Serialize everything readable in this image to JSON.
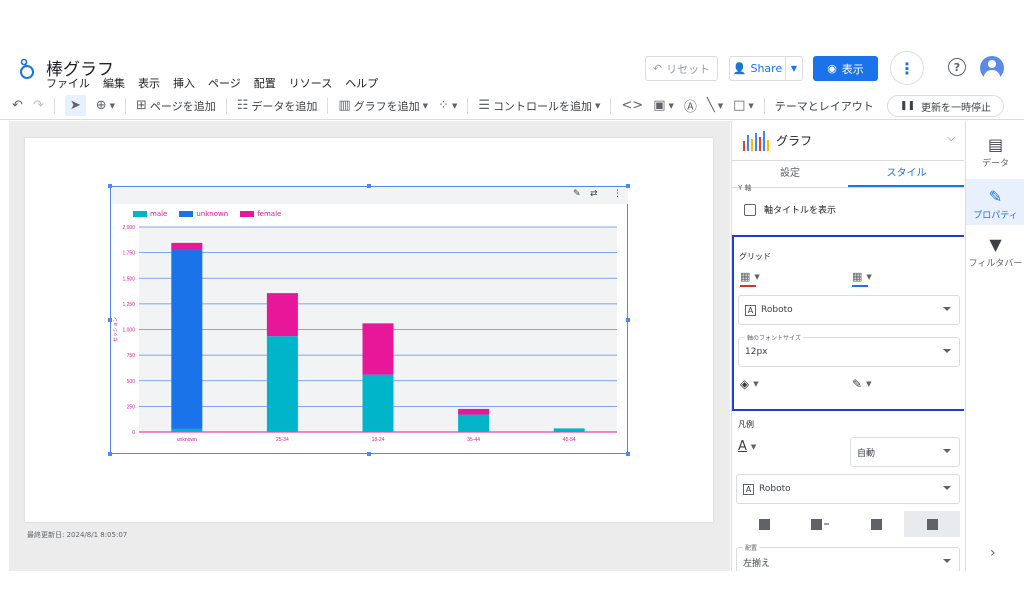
{
  "app": {
    "title": "棒グラフ",
    "menu": [
      "ファイル",
      "編集",
      "表示",
      "挿入",
      "ページ",
      "配置",
      "リソース",
      "ヘルプ"
    ],
    "reset_label": "リセット",
    "share_label": "Share",
    "view_label": "表示"
  },
  "toolbar": {
    "add_page": "ページを追加",
    "add_data": "データを追加",
    "add_chart": "グラフを追加",
    "add_control": "コントロールを追加",
    "theme_layout": "テーマとレイアウト",
    "pause_updates": "更新を一時停止"
  },
  "canvas": {
    "last_updated": "最終更新日: 2024/8/1 8:05:07"
  },
  "chart_data": {
    "type": "bar",
    "stacked": true,
    "categories": [
      "unknown",
      "25-34",
      "18-24",
      "35-44",
      "45-54"
    ],
    "series": [
      {
        "name": "male",
        "color": "#00b4c9",
        "values": [
          30,
          935,
          560,
          170,
          35
        ]
      },
      {
        "name": "unknown",
        "color": "#1a73e8",
        "values": [
          1755,
          0,
          0,
          0,
          0
        ]
      },
      {
        "name": "female",
        "color": "#e8179a",
        "values": [
          60,
          420,
          500,
          55,
          0
        ]
      }
    ],
    "ylabel": "セッション",
    "ylim": [
      0,
      2000
    ],
    "yticks": [
      "0",
      "250",
      "500",
      "750",
      "1,000",
      "1,250",
      "1,500",
      "1,750",
      "2,000"
    ],
    "grid": true,
    "legend_position": "top-left"
  },
  "panel": {
    "chart_type_label": "グラフ",
    "tab_setup": "設定",
    "tab_style": "スタイル",
    "axis_section_label": "Y 軸",
    "show_axis_title": "軸タイトルを表示",
    "grid_section": "グリッド",
    "font_family": "Roboto",
    "axis_font_size_label": "軸のフォントサイズ",
    "axis_font_size": "12px",
    "legend_section": "凡例",
    "legend_auto": "自動",
    "legend_font": "Roboto",
    "alignment_label": "配置",
    "alignment_value": "左揃え"
  },
  "rail": {
    "data": "データ",
    "properties": "プロパティ",
    "filter": "フィルタバー"
  }
}
